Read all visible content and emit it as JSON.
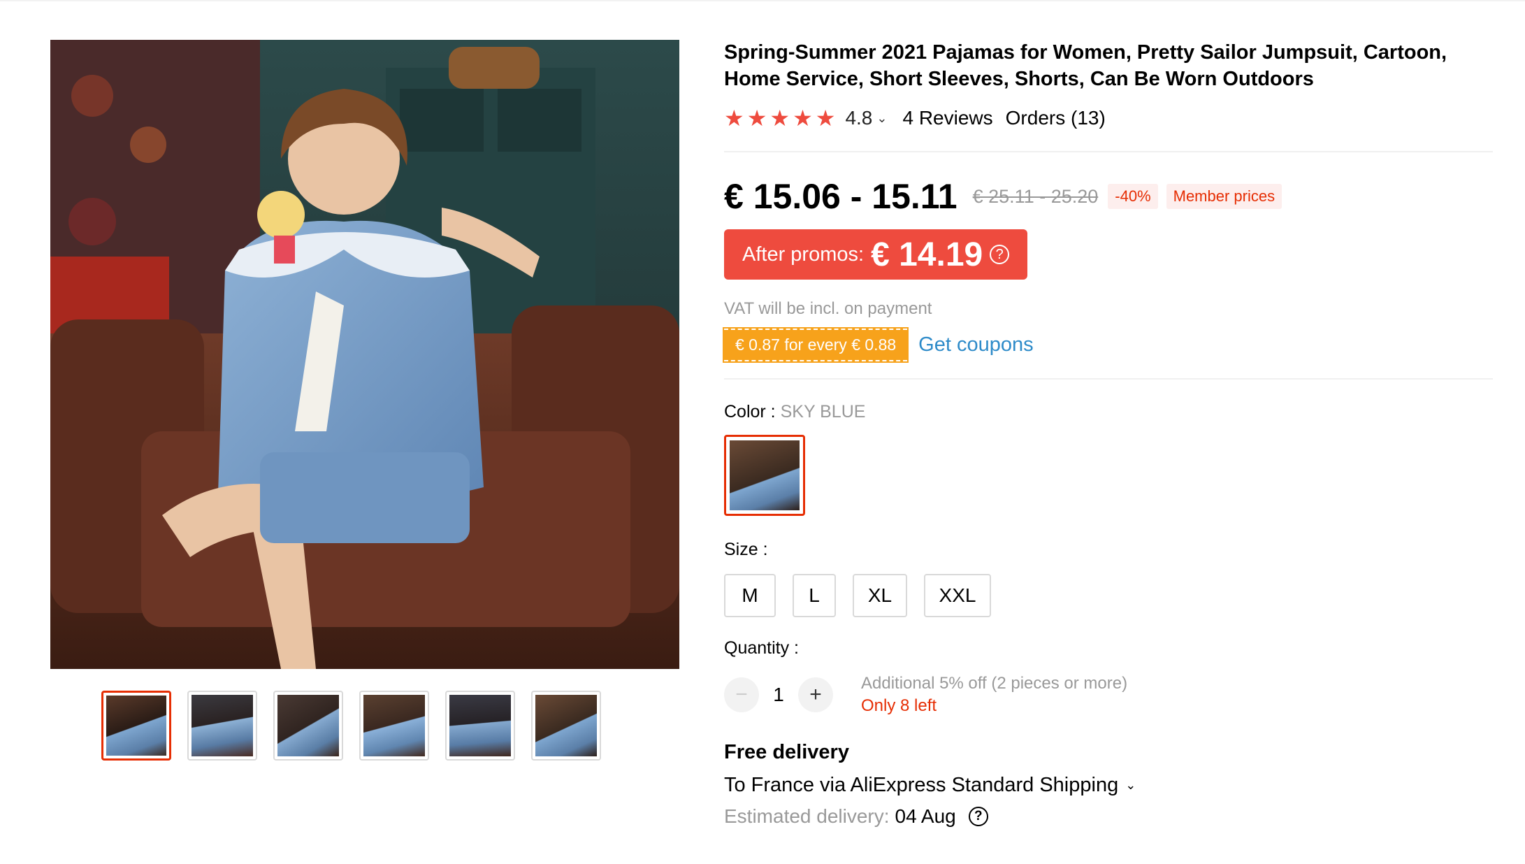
{
  "product": {
    "title": "Spring-Summer 2021 Pajamas for Women, Pretty Sailor Jumpsuit, Cartoon, Home Service, Short Sleeves, Shorts, Can Be Worn Outdoors",
    "rating_value": "4.8",
    "rating_stars": 5,
    "reviews_label": "4 Reviews",
    "orders_label": "Orders (13)"
  },
  "price": {
    "range": "€ 15.06 - 15.11",
    "original_range": "€ 25.11 - 25.20",
    "discount": "-40%",
    "member_label": "Member prices",
    "promo_label": "After promos:",
    "promo_price": "€ 14.19",
    "vat_note": "VAT will be incl. on payment",
    "coupon_text": "€ 0.87 for every € 0.88",
    "get_coupons": "Get coupons"
  },
  "color": {
    "label": "Color : ",
    "value": "SKY BLUE"
  },
  "size": {
    "label": "Size :",
    "options": [
      "M",
      "L",
      "XL",
      "XXL"
    ]
  },
  "quantity": {
    "label": "Quantity :",
    "value": "1",
    "minus": "−",
    "plus": "+",
    "additional_off": "Additional 5% off (2 pieces or more)",
    "stock": "Only 8 left"
  },
  "delivery": {
    "title": "Free delivery",
    "shipping": "To France via AliExpress Standard Shipping",
    "estimated_label": "Estimated delivery:",
    "estimated_date": "04 Aug"
  },
  "gallery": {
    "thumb_count": 6,
    "active_index": 0
  },
  "colors": {
    "accent_red": "#ee4b3e",
    "coupon_orange": "#f7a21b",
    "link_blue": "#2e8bc9"
  }
}
